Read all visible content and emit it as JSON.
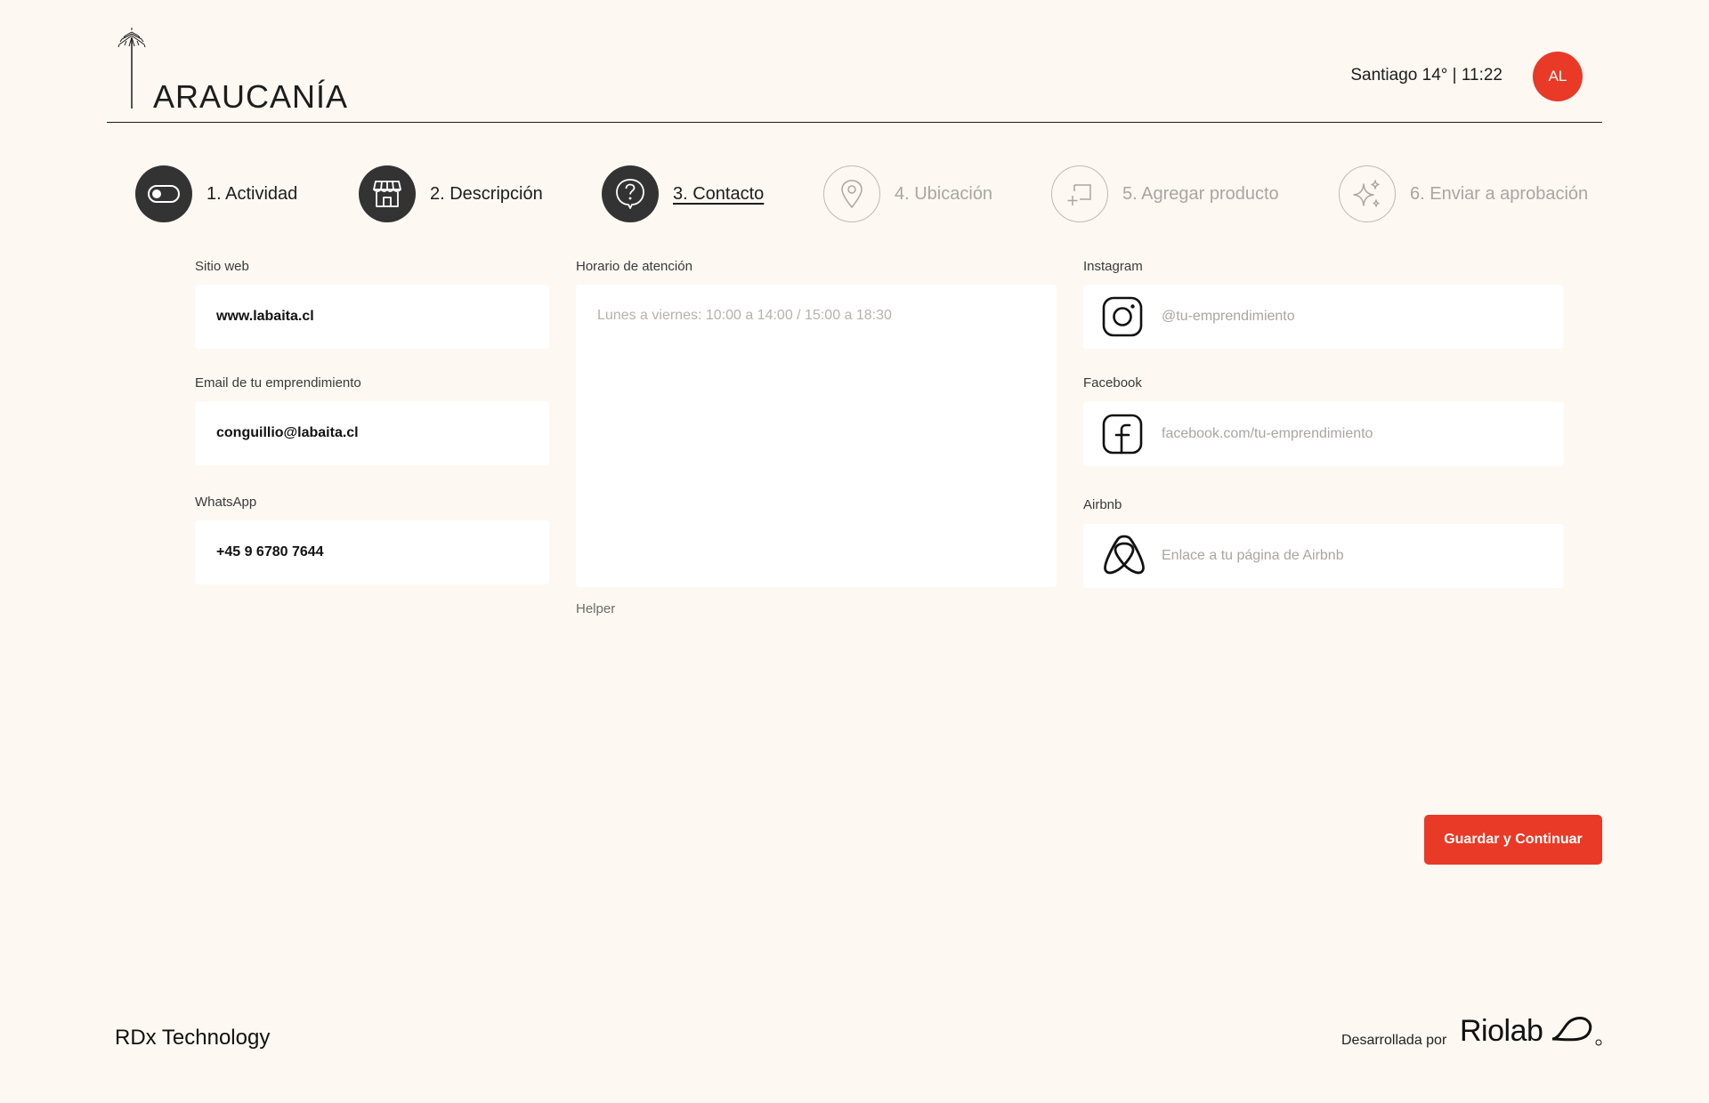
{
  "header": {
    "logo_text": "ARAUCANÍA",
    "weather": "Santiago 14° | 11:22",
    "avatar_initials": "AL"
  },
  "stepper": {
    "steps": [
      {
        "label": "1. Actividad",
        "icon": "toggle-icon",
        "state": "done"
      },
      {
        "label": "2. Descripción",
        "icon": "storefront-icon",
        "state": "done"
      },
      {
        "label": "3. Contacto",
        "icon": "question-bubble-icon",
        "state": "current"
      },
      {
        "label": "4. Ubicación",
        "icon": "map-pin-icon",
        "state": "todo"
      },
      {
        "label": "5. Agregar producto",
        "icon": "add-product-icon",
        "state": "todo"
      },
      {
        "label": "6. Enviar a aprobación",
        "icon": "sparkles-icon",
        "state": "todo"
      }
    ]
  },
  "form": {
    "website": {
      "label": "Sitio web",
      "value": "www.labaita.cl"
    },
    "email": {
      "label": "Email de tu emprendimiento",
      "value": "conguillio@labaita.cl"
    },
    "whatsapp": {
      "label": "WhatsApp",
      "value": "+45 9 6780 7644"
    },
    "hours": {
      "label": "Horario de atención",
      "placeholder": "Lunes a viernes: 10:00 a 14:00 / 15:00 a 18:30",
      "helper": "Helper"
    },
    "instagram": {
      "label": "Instagram",
      "placeholder": "@tu-emprendimiento",
      "icon": "instagram-icon"
    },
    "facebook": {
      "label": "Facebook",
      "placeholder": "facebook.com/tu-emprendimiento",
      "icon": "facebook-icon"
    },
    "airbnb": {
      "label": "Airbnb",
      "placeholder": "Enlace a tu página de Airbnb",
      "icon": "airbnb-icon"
    }
  },
  "actions": {
    "save_label": "Guardar y Continuar"
  },
  "footer": {
    "company": "RDx Technology",
    "developed_by": "Desarrollada por",
    "brand": "Riolab"
  },
  "colors": {
    "background": "#fdf8f2",
    "accent": "#e83a26",
    "step_done": "#333333",
    "muted": "#a9a6a2"
  }
}
